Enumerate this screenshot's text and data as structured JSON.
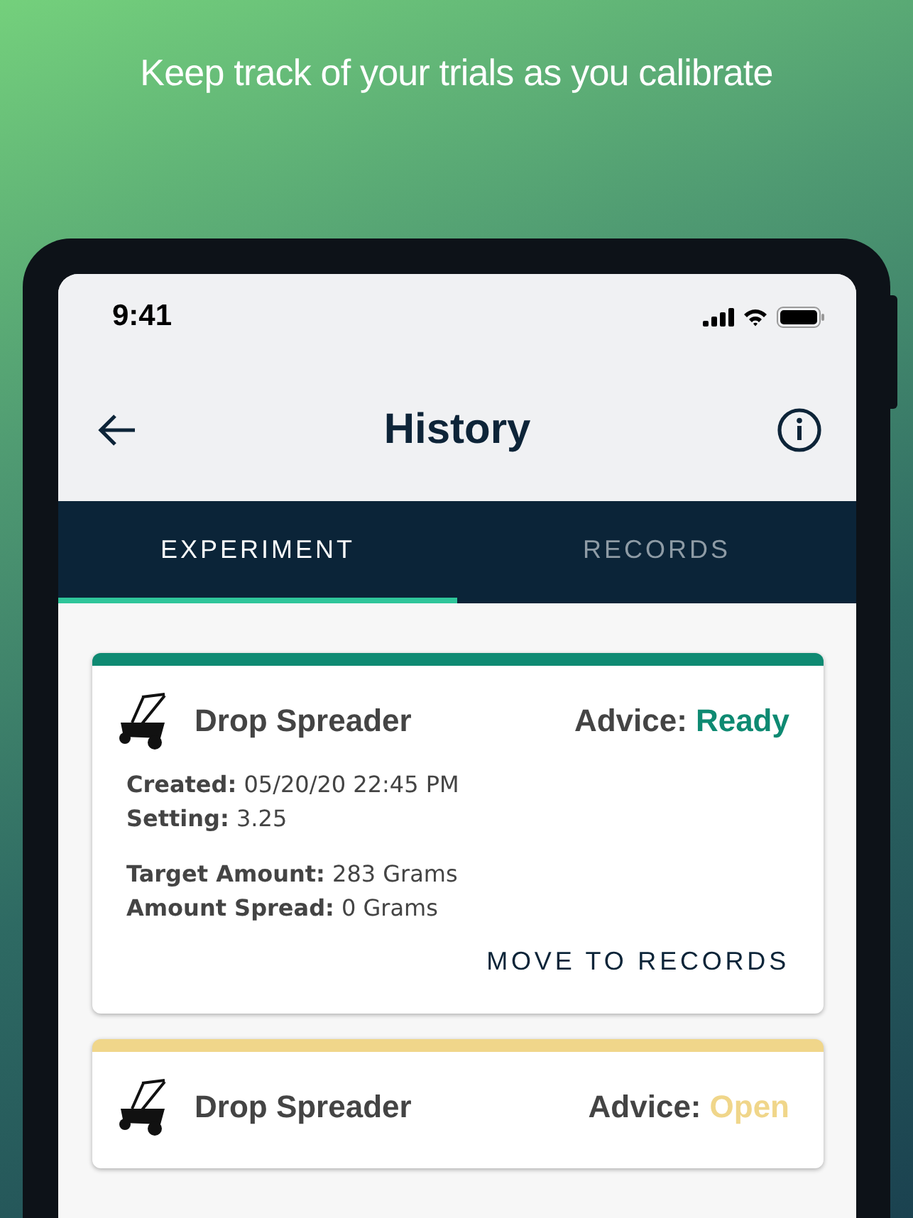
{
  "headline": "Keep track of your trials as you calibrate",
  "status_bar": {
    "time": "9:41"
  },
  "nav": {
    "title": "History"
  },
  "tabs": [
    {
      "label": "EXPERIMENT",
      "selected": true
    },
    {
      "label": "RECORDS",
      "selected": false
    }
  ],
  "cards": [
    {
      "name": "Drop Spreader",
      "advice_label": "Advice:",
      "advice": "Ready",
      "color": "#0e8a72",
      "details": [
        "**Created:** 05/20/20 22:45 PM",
        "**Setting:** 3.25"
      ],
      "amounts": [
        "**Target Amount:** 283 Grams",
        "**Amount Spread:** 0 Grams"
      ],
      "action": "MOVE TO RECORDS"
    },
    {
      "name": "Drop Spreader",
      "advice_label": "Advice:",
      "advice": "Open",
      "color": "#f0d68a"
    }
  ]
}
